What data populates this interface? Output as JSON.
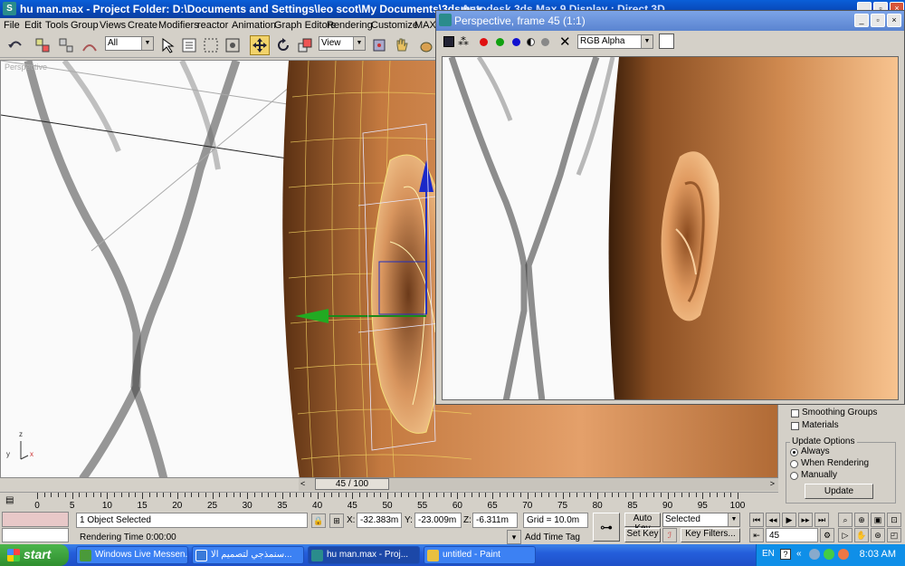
{
  "window": {
    "title": "hu man.max     - Project Folder: D:\\Documents and Settings\\leo scot\\My Documents\\3dsmax",
    "behind_title": "Autodesk 3ds Max 9     Display : Direct 3D"
  },
  "menu": [
    "File",
    "Edit",
    "Tools",
    "Group",
    "Views",
    "Create",
    "Modifiers",
    "reactor",
    "Animation",
    "Graph Editors",
    "Rendering",
    "Customize",
    "MAXS"
  ],
  "toolbar": {
    "selection_filter": "All",
    "reference_coord": "View"
  },
  "viewport": {
    "label": "Perspective",
    "axis_labels": {
      "z": "z",
      "y": "y",
      "x": "x"
    }
  },
  "render_window": {
    "title": "Perspective, frame 45 (1:1)",
    "channel_select": "RGB Alpha"
  },
  "command_panel": {
    "smoothing_groups": "Smoothing Groups",
    "materials": "Materials",
    "update_options": "Update Options",
    "always": "Always",
    "when_rendering": "When Rendering",
    "manually": "Manually",
    "update_button": "Update"
  },
  "time_slider": {
    "label": "45 / 100"
  },
  "ruler": {
    "labels": [
      "0",
      "5",
      "10",
      "15",
      "20",
      "25",
      "30",
      "35",
      "40",
      "45",
      "50",
      "55",
      "60",
      "65",
      "70",
      "75",
      "80",
      "85",
      "90",
      "95",
      "100"
    ]
  },
  "status": {
    "selected": "1 Object Selected",
    "rendering_time": "Rendering Time  0:00:00",
    "x_label": "X:",
    "x_value": "-32.383m",
    "y_label": "Y:",
    "y_value": "-23.009m",
    "z_label": "Z:",
    "z_value": "-6.311m",
    "grid": "Grid = 10.0m",
    "add_time_tag": "Add Time Tag",
    "auto_key": "Auto Key",
    "auto_key_mode": "Selected",
    "set_key": "Set Key",
    "key_filters": "Key Filters...",
    "frame": "45"
  },
  "taskbar": {
    "start": "start",
    "tasks": [
      {
        "label": "Windows Live Messen..."
      },
      {
        "label": "سنمذجي لتصميم الا..."
      },
      {
        "label": "hu man.max     - Proj..."
      },
      {
        "label": "untitled - Paint"
      }
    ],
    "lang": "EN",
    "clock": "8:03 AM"
  },
  "colors": {
    "titlebar": "#0848b8",
    "chrome": "#d4d0c8",
    "skin": "#d9905a",
    "selected_mode": "#f2d36a"
  }
}
